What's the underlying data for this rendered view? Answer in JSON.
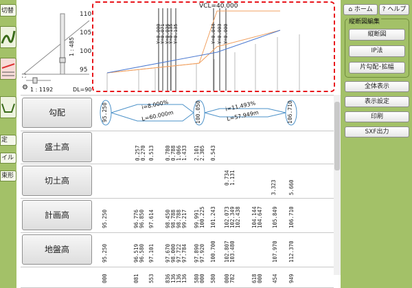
{
  "left_panel": {
    "top_button": "切替",
    "buttons": [
      "定",
      "イル",
      "束形"
    ]
  },
  "preview": {
    "scale_vertical": "1 : 485",
    "scale_horizontal": "1 : 1192",
    "datum_level": "DL=90"
  },
  "profile": {
    "vcl_label": "VCL=40.000",
    "y_ticks": [
      "110",
      "105",
      "100",
      "95"
    ],
    "y_markers": [
      "Y=0.000",
      "Y=0.071",
      "Y=0.036",
      "Y=0.135",
      "Y=0.135",
      "Y=0.044",
      "Y=0.003",
      "Y=0.000"
    ]
  },
  "table": {
    "rows": [
      {
        "header": "勾配"
      },
      {
        "header": "盛土高"
      },
      {
        "header": "切土高"
      },
      {
        "header": "計画高"
      },
      {
        "header": "地盤高"
      }
    ],
    "gradient": {
      "start": "95.250",
      "seg1_slope": "i=8.000%",
      "seg1_length": "L=60.000m",
      "mid": "100.050",
      "seg2_slope": "i=11.493%",
      "seg2_length": "L=57.949m",
      "end": "106.710"
    },
    "fill_values": [
      "0.257",
      "0.270",
      "0.513",
      "0.780",
      "0.788",
      "1.066",
      "1.433",
      "2.101",
      "2.305",
      "0.543"
    ],
    "cut_values": [
      "0.734",
      "1.131",
      "3.323",
      "5.660"
    ],
    "plan_values": [
      "95.250",
      "96.776",
      "96.850",
      "97.614",
      "98.450",
      "98.788",
      "98.788",
      "99.217",
      "99.991",
      "100.225",
      "101.243",
      "102.073",
      "102.349",
      "102.438",
      "104.144",
      "104.647",
      "105.849",
      "106.710"
    ],
    "ground_values": [
      "95.250",
      "96.519",
      "96.580",
      "97.101",
      "97.670",
      "98.000",
      "97.722",
      "97.784",
      "97.890",
      "97.920",
      "100.700",
      "102.807",
      "103.480",
      "107.970",
      "112.370"
    ],
    "last_row_values": [
      "000",
      "081",
      "553",
      "836",
      "136",
      "136",
      "136",
      "580",
      "000",
      "580",
      "000",
      "782",
      "618",
      "000",
      "454",
      "949"
    ]
  },
  "right_panel": {
    "home_label": "ホーム",
    "help_label": "ヘルプ",
    "group_title": "縦断図編集",
    "group_buttons": [
      "縦断図",
      "IP法",
      "片勾配･拡幅"
    ],
    "buttons": [
      "全体表示",
      "表示設定",
      "印刷",
      "SXF出力"
    ]
  },
  "colors": {
    "panel_green": "#a3c168",
    "plan_line": "#4a78d0",
    "ground_line": "#f0a060",
    "highlight": "#e8141a"
  }
}
